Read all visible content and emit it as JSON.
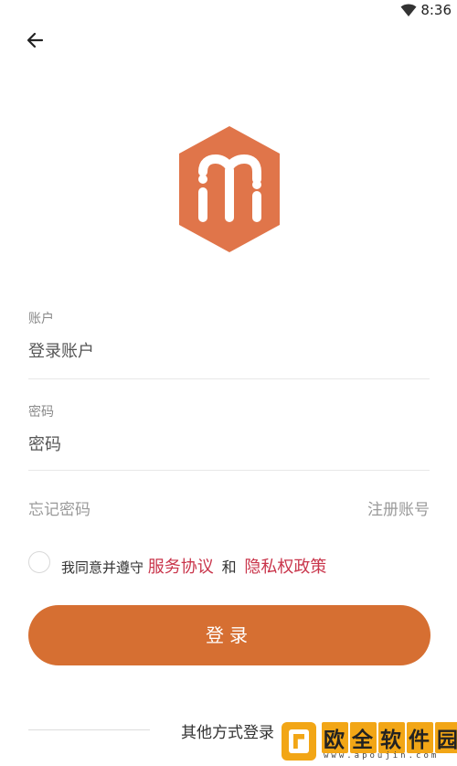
{
  "status_bar": {
    "time": "8:36",
    "wifi_icon": "wifi-icon"
  },
  "header": {
    "back_icon": "arrow-left-icon"
  },
  "logo": {
    "icon": "m-hexagon-logo",
    "color": "#e0754a"
  },
  "form": {
    "account": {
      "label": "账户",
      "placeholder": "登录账户",
      "value": ""
    },
    "password": {
      "label": "密码",
      "placeholder": "密码",
      "value": ""
    }
  },
  "links": {
    "forgot_password": "忘记密码",
    "register": "注册账号"
  },
  "agreement": {
    "checked": false,
    "prefix": "我同意并遵守",
    "service_agreement": "服务协议",
    "and": "和",
    "privacy_policy": "隐私权政策",
    "link_color": "#c9354b"
  },
  "login_button": {
    "label": "登录",
    "color": "#d66f32"
  },
  "other_login": {
    "label": "其他方式登录"
  },
  "watermark": {
    "title": "欧全软件园",
    "url": "www.apoujin.com",
    "accent": "#f2a616"
  }
}
